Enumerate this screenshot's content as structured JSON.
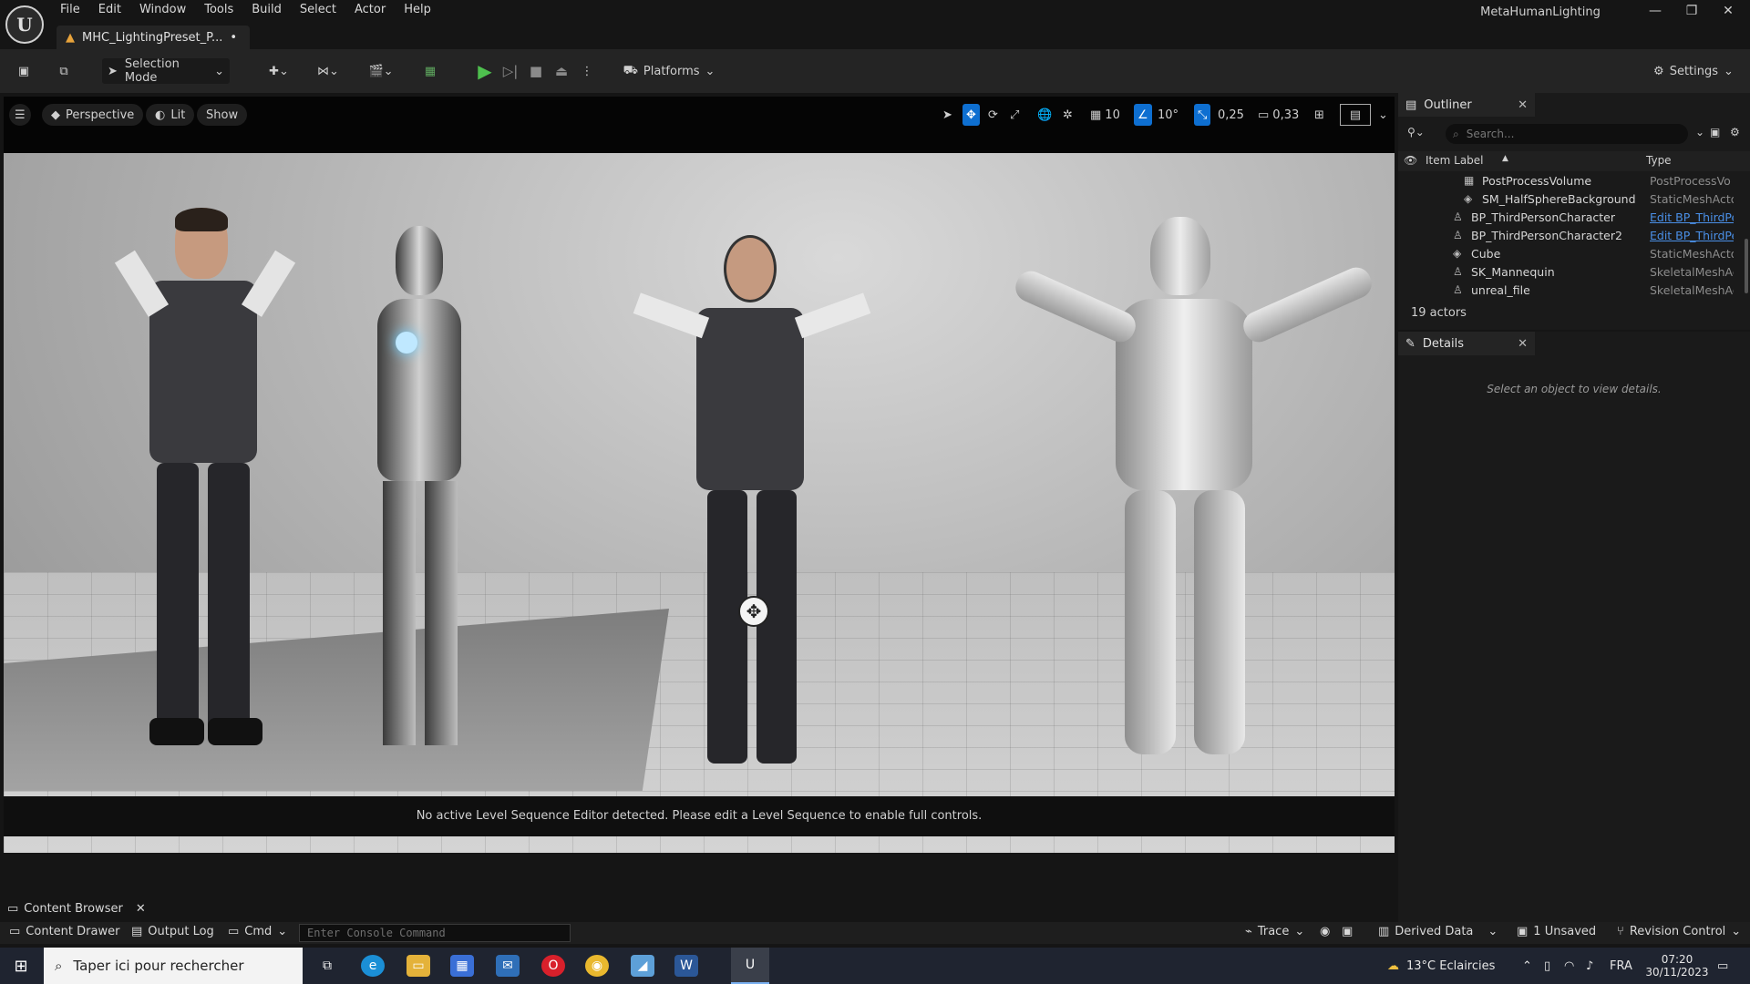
{
  "window": {
    "menu": [
      "File",
      "Edit",
      "Window",
      "Tools",
      "Build",
      "Select",
      "Actor",
      "Help"
    ],
    "project_name": "MetaHumanLighting",
    "document_tab": "MHC_LightingPreset_P...",
    "document_modified": "•"
  },
  "toolbar": {
    "selection_mode": "Selection Mode",
    "platforms": "Platforms",
    "settings": "Settings"
  },
  "viewport": {
    "perspective": "Perspective",
    "lit": "Lit",
    "show": "Show",
    "grid_snap": "10",
    "rotation_snap": "10°",
    "scale_snap": "0,25",
    "camera_speed": "0,33",
    "sequencer_message": "No active Level Sequence Editor detected. Please edit a Level Sequence to enable full controls."
  },
  "outliner": {
    "tab_title": "Outliner",
    "search_placeholder": "Search...",
    "col_label": "Item Label",
    "col_type": "Type",
    "rows": [
      {
        "label": "PostProcessVolume",
        "type": "PostProcessVo",
        "link": false
      },
      {
        "label": "SM_HalfSphereBackground",
        "type": "StaticMeshActo",
        "link": false
      },
      {
        "label": "BP_ThirdPersonCharacter",
        "type": "Edit BP_ThirdPe",
        "link": true
      },
      {
        "label": "BP_ThirdPersonCharacter2",
        "type": "Edit BP_ThirdPe",
        "link": true
      },
      {
        "label": "Cube",
        "type": "StaticMeshActo",
        "link": false
      },
      {
        "label": "SK_Mannequin",
        "type": "SkeletalMeshAc",
        "link": false
      },
      {
        "label": "unreal_file",
        "type": "SkeletalMeshAc",
        "link": false
      }
    ],
    "actor_count": "19 actors"
  },
  "details": {
    "tab_title": "Details",
    "hint": "Select an object to view details."
  },
  "bottom": {
    "content_browser_tab": "Content Browser",
    "content_drawer": "Content Drawer",
    "output_log": "Output Log",
    "cmd": "Cmd",
    "console_placeholder": "Enter Console Command",
    "trace": "Trace",
    "derived_data": "Derived Data",
    "unsaved": "1 Unsaved",
    "revision_control": "Revision Control"
  },
  "taskbar": {
    "search_text": "Taper ici pour rechercher",
    "weather": "13°C  Eclaircies",
    "language": "FRA",
    "time": "07:20",
    "date": "30/11/2023"
  },
  "colors": {
    "accent_blue": "#0e6fd1",
    "play_green": "#4ec04e",
    "link_blue": "#4a8fe6"
  }
}
